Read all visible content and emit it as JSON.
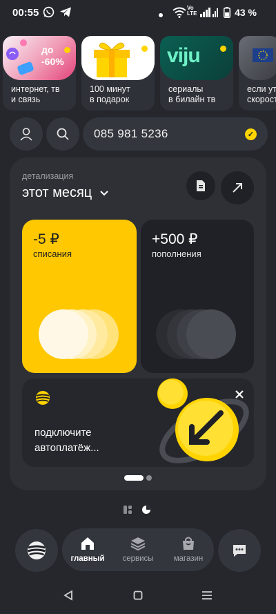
{
  "status_bar": {
    "time": "00:55",
    "volte": "Vo LTE",
    "battery": "43 %"
  },
  "stories": [
    {
      "caption": "интернет, тв\nи связь",
      "badge": "до\n-60%"
    },
    {
      "caption": "100 минут\nв подарок"
    },
    {
      "caption": "сериалы\nв билайн тв",
      "logo": "viju"
    },
    {
      "caption": "если ут\nскорост"
    }
  ],
  "phone": {
    "number": "085 981 5236"
  },
  "details": {
    "label": "детализация",
    "period": "этот месяц"
  },
  "cards": {
    "charges": {
      "amount": "-5 ₽",
      "label": "списания"
    },
    "topups": {
      "amount": "+500 ₽",
      "label": "пополнения"
    }
  },
  "promo": {
    "text": "подключите автоплатёж..."
  },
  "bottom_nav": {
    "items": [
      {
        "label": "главный",
        "icon": "home-icon"
      },
      {
        "label": "сервисы",
        "icon": "layers-icon"
      },
      {
        "label": "магазин",
        "icon": "shop-bag-icon"
      }
    ]
  },
  "colors": {
    "background": "#25272d",
    "accent": "#ffd400",
    "card_dark": "#1f2126"
  }
}
